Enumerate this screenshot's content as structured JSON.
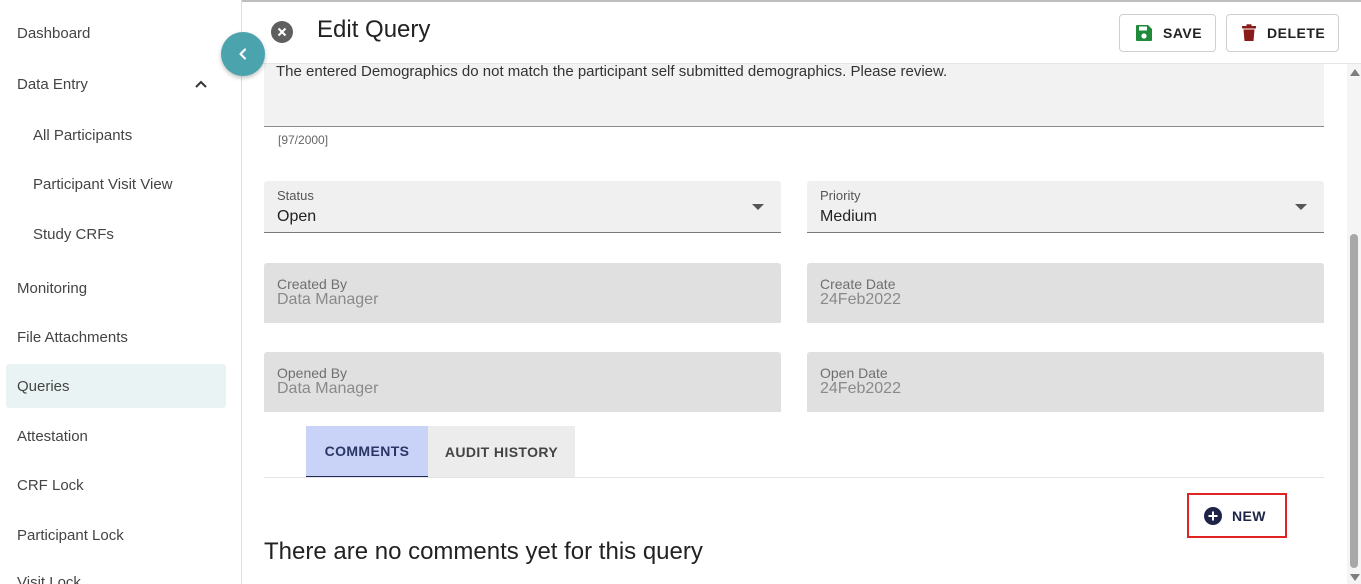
{
  "sidebar": {
    "items": [
      {
        "label": "Dashboard"
      },
      {
        "label": "Data Entry"
      },
      {
        "label": "All Participants"
      },
      {
        "label": "Participant Visit View"
      },
      {
        "label": "Study CRFs"
      },
      {
        "label": "Monitoring"
      },
      {
        "label": "File Attachments"
      },
      {
        "label": "Queries"
      },
      {
        "label": "Attestation"
      },
      {
        "label": "CRF Lock"
      },
      {
        "label": "Participant Lock"
      },
      {
        "label": "Visit Lock"
      }
    ],
    "active": "Queries",
    "collapse_icon": "chevron-left-icon"
  },
  "header": {
    "title": "Edit Query",
    "save_label": "SAVE",
    "delete_label": "DELETE"
  },
  "form": {
    "description": "The entered Demographics do not match the participant self submitted demographics. Please review.",
    "char_counter": "[97/2000]",
    "status": {
      "label": "Status",
      "value": "Open"
    },
    "priority": {
      "label": "Priority",
      "value": "Medium"
    },
    "created_by": {
      "label": "Created By",
      "value": "Data Manager"
    },
    "create_date": {
      "label": "Create Date",
      "value": "24Feb2022"
    },
    "opened_by": {
      "label": "Opened By",
      "value": "Data Manager"
    },
    "open_date": {
      "label": "Open Date",
      "value": "24Feb2022"
    }
  },
  "tabs": {
    "comments": "COMMENTS",
    "audit_history": "AUDIT HISTORY"
  },
  "comments": {
    "new_label": "NEW",
    "empty_message": "There are no comments yet for this query"
  },
  "colors": {
    "accent": "#4aa3ad",
    "save_icon": "#1f8a3a",
    "delete_icon": "#8b1a1a",
    "active_tab_bg": "#c9d3f7",
    "highlight_border": "#e02424"
  }
}
